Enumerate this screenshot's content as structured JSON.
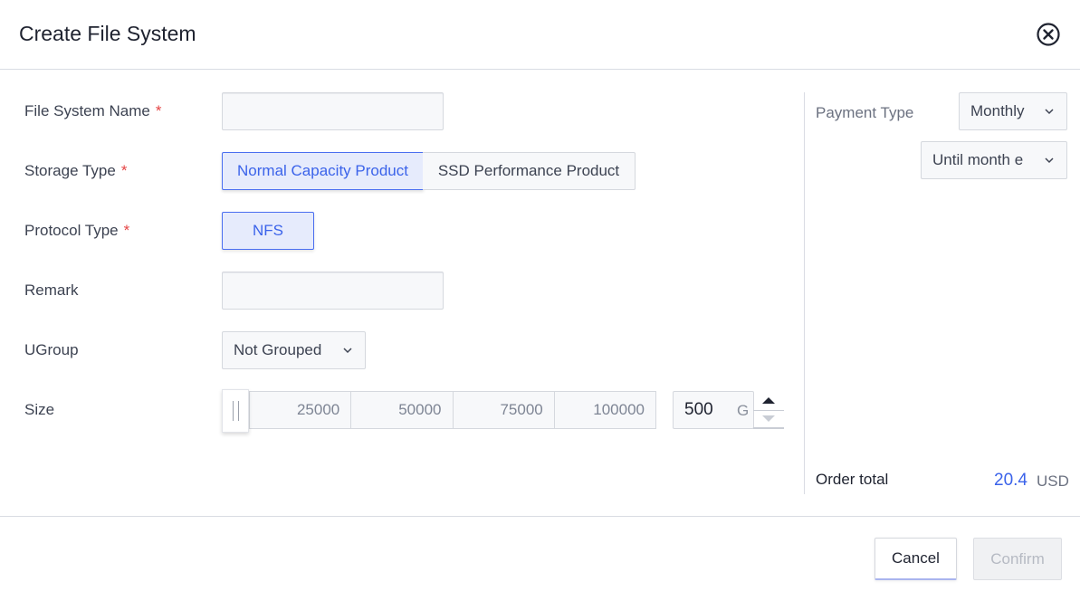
{
  "dialog": {
    "title": "Create File System"
  },
  "form": {
    "name_label": "File System Name",
    "storage_label": "Storage Type",
    "protocol_label": "Protocol Type",
    "remark_label": "Remark",
    "ugroup_label": "UGroup",
    "size_label": "Size",
    "required_mark": "*",
    "name_value": "",
    "remark_value": "",
    "storage_options": [
      "Normal Capacity Product",
      "SSD Performance Product"
    ],
    "storage_selected": "Normal Capacity Product",
    "protocol_option": "NFS",
    "ugroup_value": "Not Grouped",
    "size_ticks": [
      "25000",
      "50000",
      "75000",
      "100000"
    ],
    "size_value": "500",
    "size_unit": "G"
  },
  "payment": {
    "label": "Payment Type",
    "type_value": "Monthly",
    "period_value": "Until month e"
  },
  "order": {
    "label": "Order total",
    "amount": "20.4",
    "currency": "USD"
  },
  "footer": {
    "cancel_label": "Cancel",
    "confirm_label": "Confirm"
  },
  "colors": {
    "accent": "#3b63ea",
    "required": "#e54545",
    "border": "#d5d8de",
    "disabled_text": "#b6bac3"
  }
}
